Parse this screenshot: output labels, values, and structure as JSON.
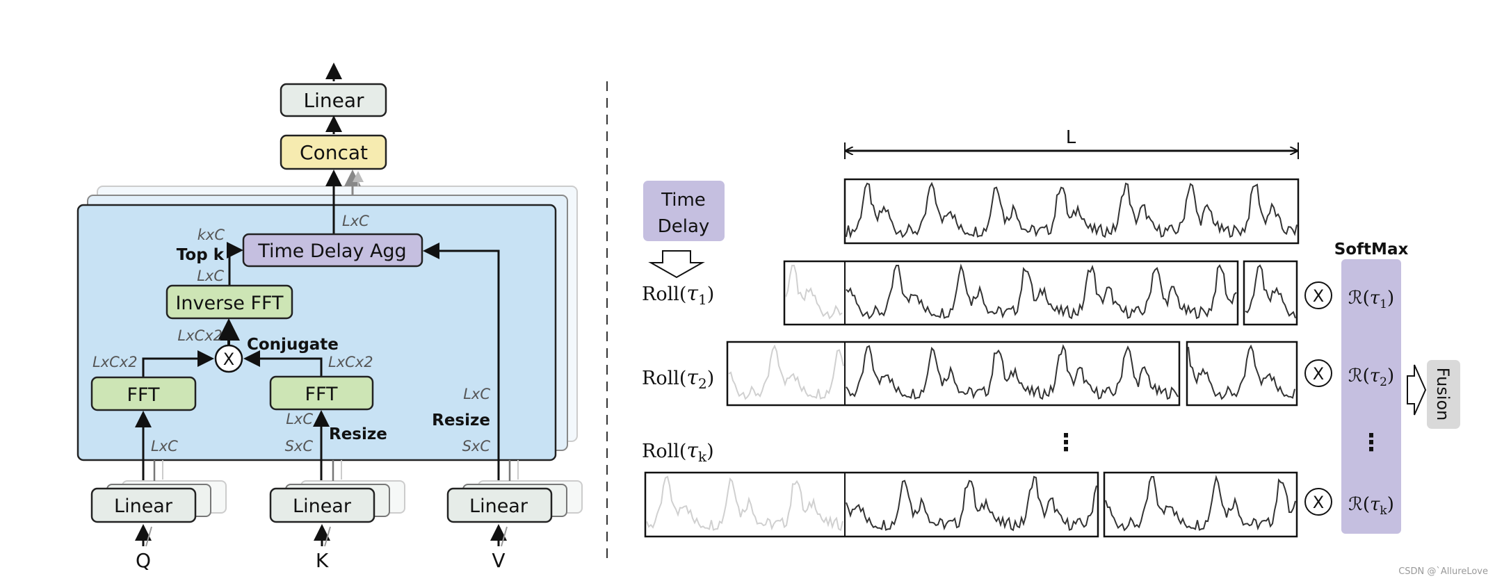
{
  "left": {
    "output_linear": "Linear",
    "concat": "Concat",
    "time_delay_agg": "Time Delay Agg",
    "inverse_fft": "Inverse FFT",
    "fft_q": "FFT",
    "fft_k": "FFT",
    "multiply_symbol": "X",
    "linear_q": "Linear",
    "linear_k": "Linear",
    "linear_v": "Linear",
    "input_q": "Q",
    "input_k": "K",
    "input_v": "V",
    "labels": {
      "agg_out": "LxC",
      "topk_dim": "kxC",
      "top_k": "Top k",
      "ifft_out": "LxC",
      "mult_out": "LxCx2",
      "conjugate": "Conjugate",
      "fft_q_out": "LxCx2",
      "fft_k_out": "LxCx2",
      "q_in": "LxC",
      "k_resized": "LxC",
      "k_resize": "Resize",
      "k_in": "SxC",
      "v_resized": "LxC",
      "v_resize": "Resize",
      "v_in": "SxC"
    },
    "colors": {
      "panel": "#c8e2f4",
      "linear": "#e6ece8",
      "concat": "#f6ebb0",
      "agg": "#c5bfe0",
      "fft": "#cde5b5"
    }
  },
  "right": {
    "length_label": "L",
    "time_delay": [
      "Time",
      "Delay"
    ],
    "rolls": [
      {
        "prefix": "Roll(",
        "sym": "τ",
        "sub": "1",
        "suffix": ")"
      },
      {
        "prefix": "Roll(",
        "sym": "τ",
        "sub": "2",
        "suffix": ")"
      },
      {
        "prefix": "Roll(",
        "sym": "τ",
        "sub": "k",
        "suffix": ")"
      }
    ],
    "multiply_symbol": "X",
    "softmax": "SoftMax",
    "weights": [
      {
        "prefix": "ℛ(",
        "sym": "τ",
        "sub": "1",
        "suffix": ")"
      },
      {
        "prefix": "ℛ(",
        "sym": "τ",
        "sub": "2",
        "suffix": ")"
      },
      {
        "prefix": "ℛ(",
        "sym": "τ",
        "sub": "k",
        "suffix": ")"
      }
    ],
    "ellipsis": "⋮",
    "fusion": "Fusion",
    "colors": {
      "purple": "#c5bfe0",
      "fusion": "#d9d9d9"
    }
  },
  "watermark": "CSDN @`AllureLove"
}
